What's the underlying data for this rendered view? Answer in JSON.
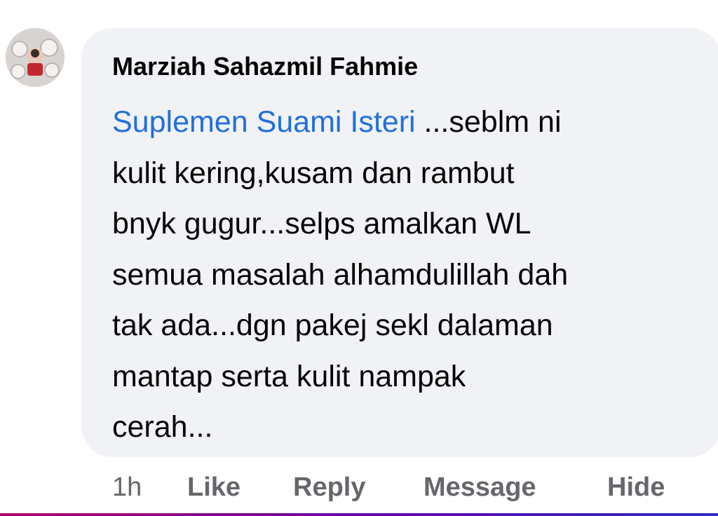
{
  "comment": {
    "author": "Marziah Sahazmil Fahmie",
    "mention": "Suplemen Suami Isteri",
    "text_line_1": " ...seblm ni",
    "text_lines": [
      "kulit kering,kusam dan rambut",
      "bnyk gugur...selps amalkan WL",
      "semua masalah alhamdulillah dah",
      "tak ada...dgn pakej sekl dalaman",
      "mantap serta kulit nampak",
      "cerah..."
    ]
  },
  "actions": {
    "time": "1h",
    "like": "Like",
    "reply": "Reply",
    "message": "Message",
    "hide": "Hide"
  },
  "colors": {
    "bubble": "#f0f2f5",
    "mention": "#216fdb",
    "text": "#050505",
    "muted": "#65676b"
  }
}
